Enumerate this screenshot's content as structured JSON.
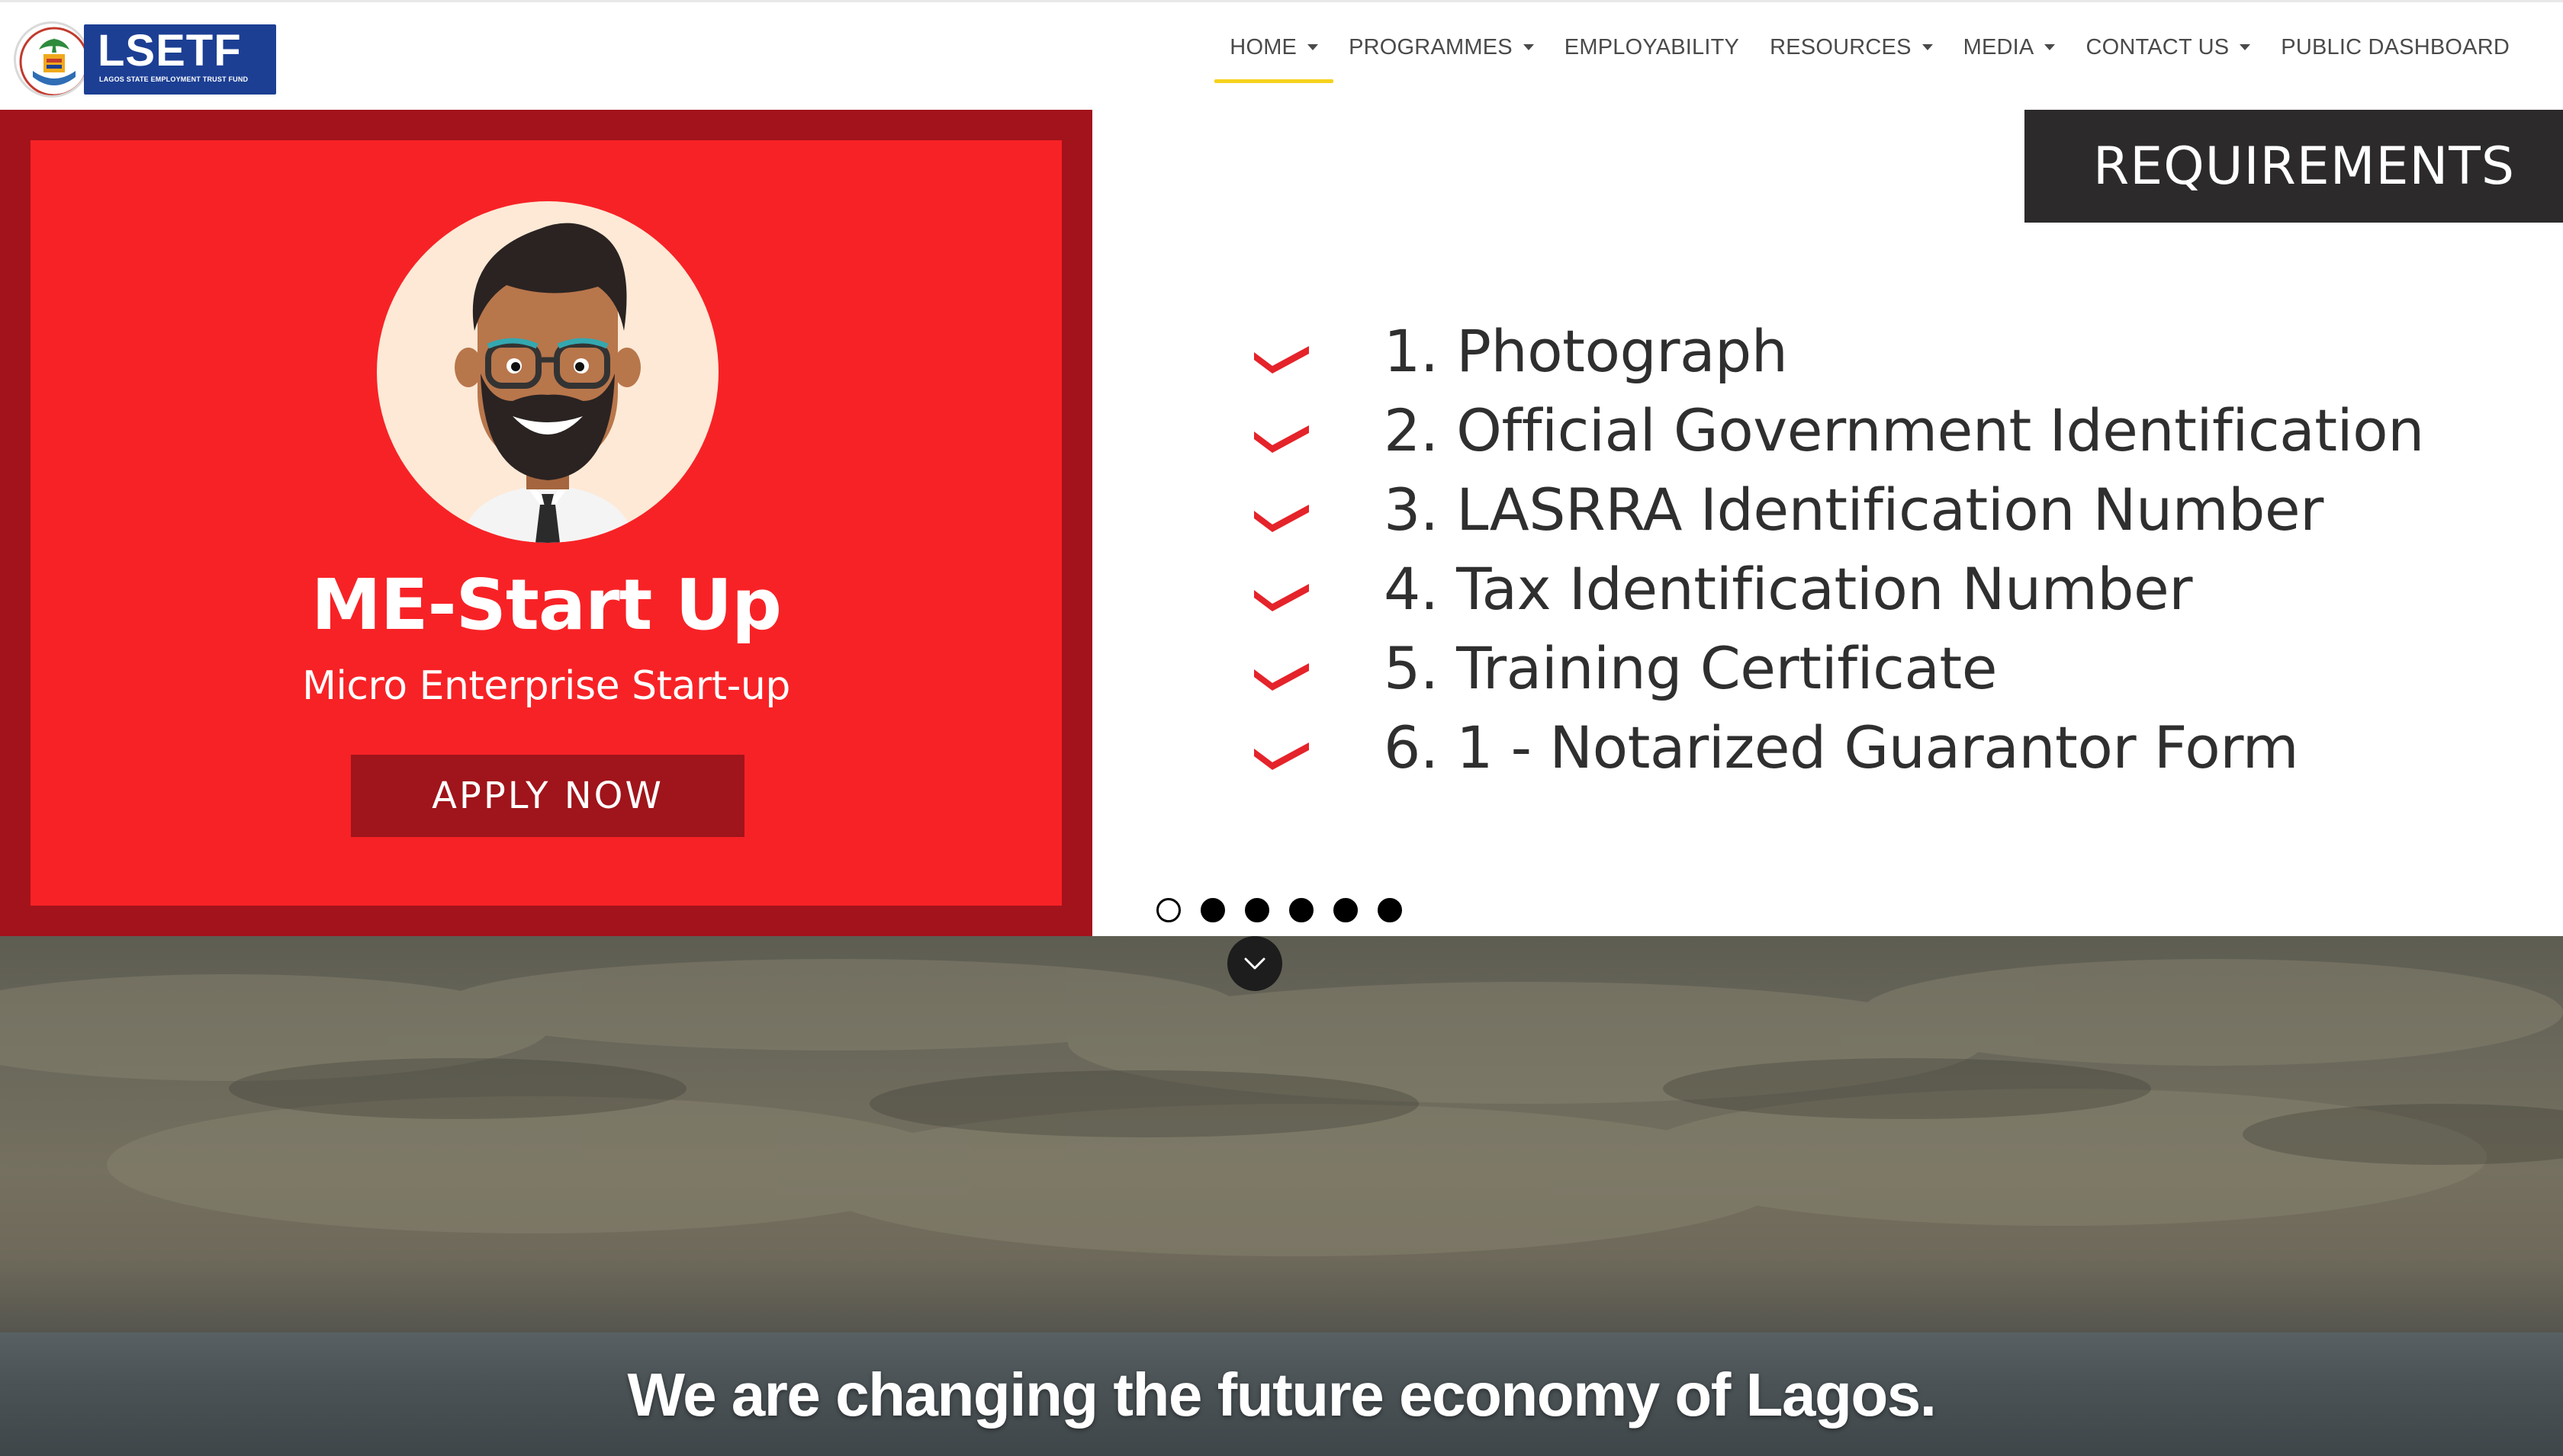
{
  "brand": {
    "logo_text": "LSETF",
    "logo_subtext": "LAGOS STATE EMPLOYMENT TRUST FUND",
    "primary_color": "#1c3f94"
  },
  "nav": {
    "items": [
      {
        "label": "HOME",
        "has_dropdown": true,
        "active": true
      },
      {
        "label": "PROGRAMMES",
        "has_dropdown": true,
        "active": false
      },
      {
        "label": "EMPLOYABILITY",
        "has_dropdown": false,
        "active": false
      },
      {
        "label": "RESOURCES",
        "has_dropdown": true,
        "active": false
      },
      {
        "label": "MEDIA",
        "has_dropdown": true,
        "active": false
      },
      {
        "label": "CONTACT US",
        "has_dropdown": true,
        "active": false
      },
      {
        "label": "PUBLIC DASHBOARD",
        "has_dropdown": false,
        "active": false
      }
    ],
    "active_underline_color": "#f5d21e"
  },
  "slider": {
    "promo": {
      "title": "ME-Start Up",
      "subtitle": "Micro Enterprise Start-up",
      "button_label": "APPLY NOW",
      "frame_color": "#a3131b",
      "panel_color": "#f72226"
    },
    "requirements": {
      "heading": "REQUIREMENTS",
      "items": [
        "1. Photograph",
        "2. Official Government Identification",
        "3. LASRRA Identification Number",
        "4. Tax Identification Number",
        "5. Training Certificate",
        "6. 1 - Notarized Guarantor Form"
      ],
      "check_color": "#e5232a"
    },
    "dots": {
      "count": 6,
      "active_index": 0
    }
  },
  "hero": {
    "tagline": "We are changing the future economy of Lagos.",
    "scroll_icon": "chevron-down-icon"
  }
}
